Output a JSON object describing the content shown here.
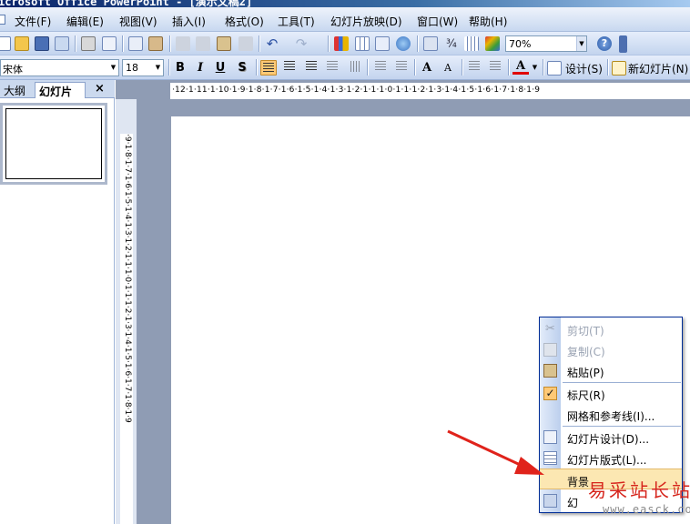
{
  "window": {
    "title": "icrosoft Office PowerPoint - [演示文稿2]"
  },
  "menubar": {
    "items": [
      "文件(F)",
      "编辑(E)",
      "视图(V)",
      "插入(I)",
      "格式(O)",
      "工具(T)",
      "幻灯片放映(D)",
      "窗口(W)",
      "帮助(H)"
    ]
  },
  "toolbar_standard": {
    "zoom_value": "70%",
    "help_icon": "?"
  },
  "toolbar_formatting": {
    "font_name": "宋体",
    "font_size": "18",
    "bold": "B",
    "italic": "I",
    "underline": "U",
    "shadow": "S",
    "grow_font": "A",
    "shrink_font": "A",
    "font_color": "A",
    "design_label": "设计(S)",
    "new_slide_label": "新幻灯片(N)"
  },
  "pane": {
    "tabs": [
      "大纲",
      "幻灯片"
    ],
    "close": "×",
    "active_tab": "幻灯片"
  },
  "rulers": {
    "horizontal": "·12·1·11·1·10·1·9·1·8·1·7·1·6·1·5·1·4·1·3·1·2·1·1·1·0·1·1·1·2·1·3·1·4·1·5·1·6·1·7·1·8·1·9",
    "vertical": "·9·1·8·1·7·1·6·1·5·1·4·1·3·1·2·1·1·1·0·1·1·1·2·1·3·1·4·1·5·1·6·1·7·1·8·1·9"
  },
  "context_menu": {
    "items": [
      {
        "label": "剪切(T)",
        "enabled": false,
        "icon": "scissors-icon"
      },
      {
        "label": "复制(C)",
        "enabled": false,
        "icon": "copy-icon"
      },
      {
        "label": "粘贴(P)",
        "enabled": true,
        "icon": "paste-icon"
      },
      {
        "label": "标尺(R)",
        "enabled": true,
        "checked": true,
        "icon": "check-icon"
      },
      {
        "label": "网格和参考线(I)...",
        "enabled": true,
        "icon": ""
      },
      {
        "label": "幻灯片设计(D)...",
        "enabled": true,
        "icon": "slide-design-icon"
      },
      {
        "label": "幻灯片版式(L)...",
        "enabled": true,
        "icon": "slide-layout-icon"
      },
      {
        "label": "背景",
        "enabled": true,
        "hovered": true,
        "icon": ""
      },
      {
        "label": "幻",
        "enabled": true,
        "icon": "slide-show-icon"
      }
    ]
  },
  "watermark": {
    "brand": "易采站长站",
    "url": "www.easck.com"
  },
  "colors": {
    "accent": "#ffc976",
    "menu_border": "#002d96",
    "arrow": "#e0231b",
    "workspace": "#8f9cb4"
  }
}
